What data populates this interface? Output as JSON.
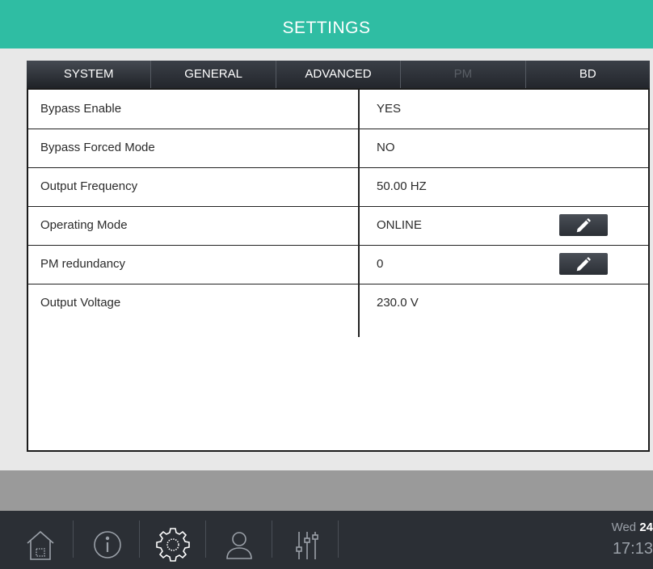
{
  "header": {
    "title": "SETTINGS"
  },
  "tabs": [
    {
      "label": "SYSTEM",
      "state": "active"
    },
    {
      "label": "GENERAL",
      "state": "normal"
    },
    {
      "label": "ADVANCED",
      "state": "normal"
    },
    {
      "label": "PM",
      "state": "disabled"
    },
    {
      "label": "BD",
      "state": "normal"
    }
  ],
  "rows": [
    {
      "label": "Bypass Enable",
      "value": "YES"
    },
    {
      "label": "Bypass Forced Mode",
      "value": "NO"
    },
    {
      "label": "Output Frequency",
      "value": "50.00 HZ"
    },
    {
      "label": "Operating Mode",
      "value": "ONLINE",
      "editable": true
    },
    {
      "label": "PM redundancy",
      "value": "0",
      "editable": true
    },
    {
      "label": "Output Voltage",
      "value": "230.0 V"
    }
  ],
  "footer": {
    "nav": [
      "home-icon",
      "info-icon",
      "settings-gear-icon",
      "user-icon",
      "sliders-icon"
    ],
    "day": "Wed",
    "date": "24",
    "time": "17:13"
  },
  "colors": {
    "accent": "#2fbda3",
    "dark": "#2b2f35"
  }
}
